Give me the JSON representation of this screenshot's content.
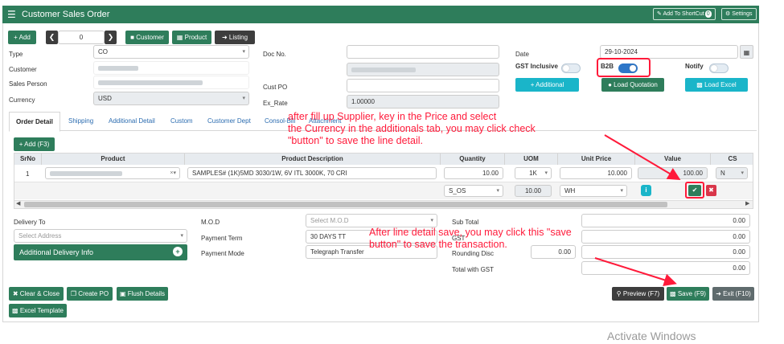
{
  "header": {
    "title": "Customer Sales Order",
    "shortcut_label": "Add To ShortCut",
    "shortcut_count": "0",
    "settings_label": "Settings"
  },
  "toolbar": {
    "add_label": "+ Add",
    "record_value": "0",
    "customer_label": "Customer",
    "product_label": "Product",
    "listing_label": "Listing"
  },
  "form": {
    "type_label": "Type",
    "type_value": "CO",
    "customer_label": "Customer",
    "sales_person_label": "Sales Person",
    "currency_label": "Currency",
    "currency_value": "USD",
    "doc_no_label": "Doc No.",
    "cust_po_label": "Cust PO",
    "ex_rate_label": "Ex_Rate",
    "ex_rate_value": "1.00000",
    "date_label": "Date",
    "date_value": "29-10-2024",
    "gst_inclusive_label": "GST Inclusive",
    "b2b_label": "B2B",
    "notify_label": "Notify",
    "additional_label": "+ Additional",
    "load_quotation_label": "Load Quotation",
    "load_excel_label": "Load Excel"
  },
  "tabs": [
    "Order Detail",
    "Shipping",
    "Additional Detail",
    "Custom",
    "Customer Dept",
    "Consol-Bill",
    "Attachment"
  ],
  "grid": {
    "add_label": "+ Add (F3)",
    "columns": [
      "SrNo",
      "Product",
      "Product Description",
      "Quantity",
      "UOM",
      "Unit Price",
      "Value",
      "CS"
    ],
    "row": {
      "srno": "1",
      "description": "SAMPLES# (1K)5MD 3030/1W, 6V ITL 3000K, 70 CRI",
      "quantity": "10.00",
      "uom": "1K",
      "unit_price": "10.000",
      "value": "100.00",
      "cs": "N"
    },
    "row2": {
      "location": "S_OS",
      "qty2": "10.00",
      "warehouse": "WH"
    }
  },
  "bottom": {
    "delivery_to_label": "Delivery To",
    "select_address_placeholder": "Select Address",
    "additional_delivery_label": "Additional Delivery Info",
    "mod_label": "M.O.D",
    "mod_placeholder": "Select M.O.D",
    "payment_term_label": "Payment Term",
    "payment_term_value": "30 DAYS TT",
    "payment_mode_label": "Payment Mode",
    "payment_mode_value": "Telegraph Transfer",
    "subtotal_label": "Sub Total",
    "subtotal_value": "0.00",
    "gst_label": "GST",
    "gst_value": "0.00",
    "rounding_label": "Rounding Disc",
    "rounding_small_value": "0.00",
    "rounding_value": "0.00",
    "total_label": "Total with GST",
    "total_value": "0.00",
    "blank_value": "0.00"
  },
  "footer": {
    "clear_close_label": "Clear & Close",
    "create_po_label": "Create PO",
    "flush_label": "Flush Details",
    "excel_template_label": "Excel Template",
    "preview_label": "Preview (F7)",
    "save_label": "Save (F9)",
    "exit_label": "Exit (F10)"
  },
  "annotations": {
    "note1_line1": "after fill up Supplier, key in the Price and select",
    "note1_line2": "the Currency in the additionals tab, you may click check",
    "note1_line3": "\"button\" to save the line detail.",
    "note2_line1": "After line detail save, you may click this \"save",
    "note2_line2": "button\" to save the transaction."
  },
  "watermark": "Activate Windows",
  "colors": {
    "primary": "#2e7d5b",
    "annotation": "#ff1a3a",
    "toggle_on": "#2d76c8",
    "accent": "#1ab5c9"
  }
}
